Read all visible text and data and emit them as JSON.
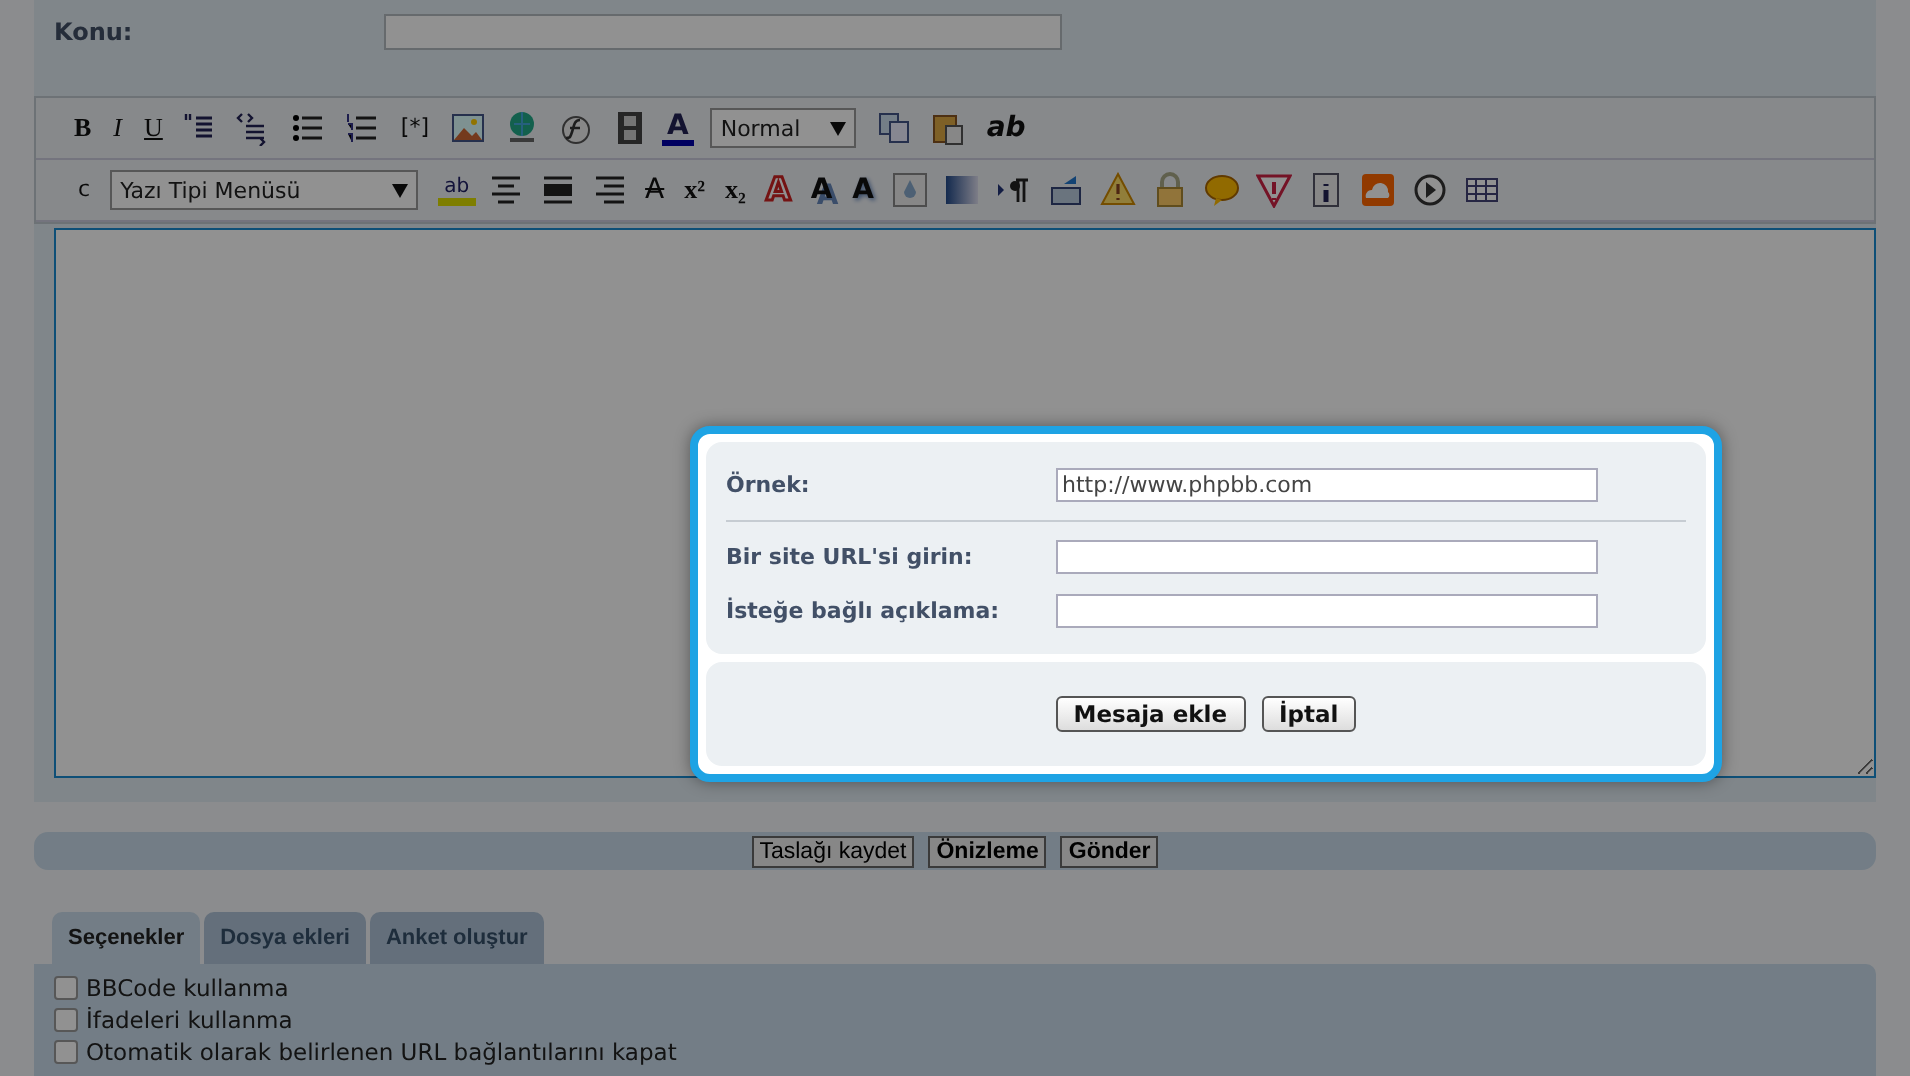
{
  "subject": {
    "label": "Konu:"
  },
  "toolbar_1": [
    {
      "kind": "bold",
      "label": "B"
    },
    {
      "kind": "italic",
      "label": "I"
    },
    {
      "kind": "underline",
      "label": "U"
    },
    {
      "kind": "quote"
    },
    {
      "kind": "code"
    },
    {
      "kind": "list"
    },
    {
      "kind": "olist"
    },
    {
      "kind": "plain",
      "label": "[*]"
    },
    {
      "kind": "image"
    },
    {
      "kind": "globe"
    },
    {
      "kind": "flash"
    },
    {
      "kind": "film"
    },
    {
      "kind": "color",
      "label": "A"
    },
    {
      "kind": "select",
      "label": "Normal"
    },
    {
      "kind": "copy"
    },
    {
      "kind": "paste"
    },
    {
      "kind": "bolditalic",
      "label": "ab"
    }
  ],
  "toolbar_2": [
    {
      "kind": "plain",
      "label": "c"
    },
    {
      "kind": "select",
      "label": "Yazı Tipi Menüsü"
    },
    {
      "kind": "highlight",
      "label": "ab"
    },
    {
      "kind": "center"
    },
    {
      "kind": "justify"
    },
    {
      "kind": "right"
    },
    {
      "kind": "strike",
      "label": "A"
    },
    {
      "kind": "sup",
      "label": "x²"
    },
    {
      "kind": "sub",
      "label": "x₂"
    },
    {
      "kind": "outline",
      "label": "A"
    },
    {
      "kind": "shadow",
      "label": "A"
    },
    {
      "kind": "glow",
      "label": "A"
    },
    {
      "kind": "drop"
    },
    {
      "kind": "gradient"
    },
    {
      "kind": "para"
    },
    {
      "kind": "inbox"
    },
    {
      "kind": "warning"
    },
    {
      "kind": "lock"
    },
    {
      "kind": "bubble"
    },
    {
      "kind": "alert"
    },
    {
      "kind": "info"
    },
    {
      "kind": "cloud"
    },
    {
      "kind": "play"
    },
    {
      "kind": "table"
    }
  ],
  "actions": [
    {
      "label": "Taslağı kaydet",
      "primary": false
    },
    {
      "label": "Önizleme",
      "primary": true
    },
    {
      "label": "Gönder",
      "primary": true
    }
  ],
  "tabs": [
    {
      "label": "Seçenekler",
      "selected": true
    },
    {
      "label": "Dosya ekleri",
      "selected": false
    },
    {
      "label": "Anket oluştur",
      "selected": false
    }
  ],
  "options": [
    {
      "label": "BBCode kullanma",
      "checked": false
    },
    {
      "label": "İfadeleri kullanma",
      "checked": false
    },
    {
      "label": "Otomatik olarak belirlenen URL bağlantılarını kapat",
      "checked": false
    }
  ],
  "dialog": {
    "example_label": "Örnek:",
    "example_value": "http://www.phpbb.com",
    "url_label": "Bir site URL'si girin:",
    "desc_label": "İsteğe bağlı açıklama:",
    "buttons": [
      "Mesaja ekle",
      "İptal"
    ]
  }
}
